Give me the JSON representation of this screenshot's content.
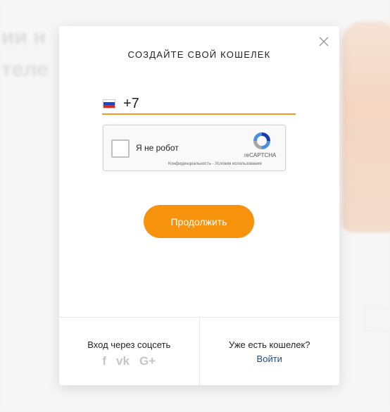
{
  "background": {
    "line1": "ии н",
    "line2": "теле",
    "line3": "",
    "line4": ""
  },
  "modal": {
    "title": "СОЗДАЙТЕ СВОЙ КОШЕЛЕК",
    "close_icon": "close-icon",
    "phone": {
      "country_flag": "russia-flag-icon",
      "value": "+7",
      "accent_color": "#f39a1d"
    },
    "recaptcha": {
      "label": "Я не робот",
      "brand": "reCAPTCHA",
      "links": "Конфиденциальность - Условия использования"
    },
    "continue_label": "Продолжить",
    "button_color": "#f7920d",
    "footer": {
      "social_label": "Вход через соцсеть",
      "social_icons": [
        {
          "icon": "facebook-icon",
          "glyph": "f"
        },
        {
          "icon": "vk-icon",
          "glyph": "vk"
        },
        {
          "icon": "google-plus-icon",
          "glyph": "G+"
        }
      ],
      "have_wallet_label": "Уже есть кошелек?",
      "login_label": "Войти",
      "link_color": "#1b4d8c"
    }
  }
}
